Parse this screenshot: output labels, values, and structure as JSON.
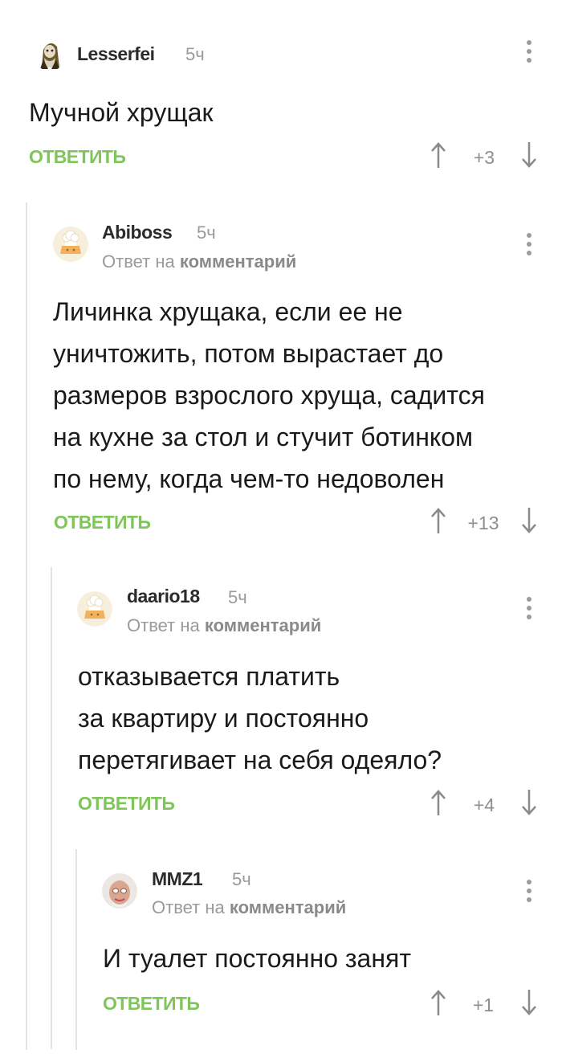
{
  "comments": [
    {
      "author": "Lesserfei",
      "time": "5ч",
      "reply_prefix": "",
      "reply_target": "",
      "text": "Мучной хрущак",
      "reply_label": "ОТВЕТИТЬ",
      "score": "+3",
      "avatar": "character-avatar"
    },
    {
      "author": "Abiboss",
      "time": "5ч",
      "reply_prefix": "Ответ на",
      "reply_target": "комментарий",
      "text": "Личинка хрущака, если ее не\nуничтожить, потом вырастает до\nразмеров взрослого хруща, садится\nна кухне за стол и стучит ботинком\nпо нему, когда чем-то недоволен",
      "reply_label": "ОТВЕТИТЬ",
      "score": "+13",
      "avatar": "default-chef-avatar"
    },
    {
      "author": "daario18",
      "time": "5ч",
      "reply_prefix": "Ответ на",
      "reply_target": "комментарий",
      "text": "отказывается платить\nза квартиру и постоянно\nперетягивает на себя одеяло?",
      "reply_label": "ОТВЕТИТЬ",
      "score": "+4",
      "avatar": "default-chef-avatar"
    },
    {
      "author": "MMZ1",
      "time": "5ч",
      "reply_prefix": "Ответ на",
      "reply_target": "комментарий",
      "text": "И туалет постоянно занят",
      "reply_label": "ОТВЕТИТЬ",
      "score": "+1",
      "avatar": "elder-face-avatar"
    }
  ],
  "colors": {
    "reply_green": "#7fc55a",
    "meta_gray": "#9a9a9a",
    "thread_line": "#e3e3e3"
  }
}
